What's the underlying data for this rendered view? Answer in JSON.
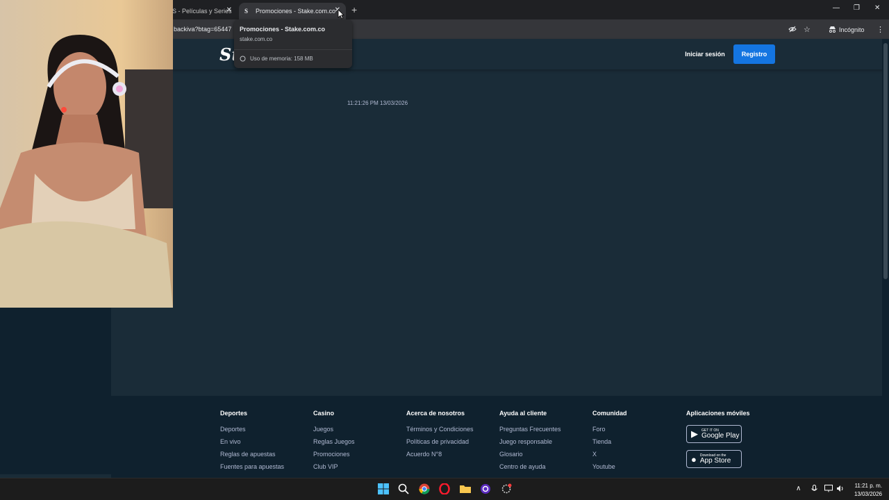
{
  "browser": {
    "tabs": [
      {
        "title": "S - Películas y Series",
        "close": "✕"
      },
      {
        "title": "Promociones - Stake.com.co",
        "favicon": "S",
        "close": "✕"
      }
    ],
    "new_tab": "+",
    "window_controls": {
      "minimize": "—",
      "maximize": "❐",
      "close": "✕"
    },
    "url_text": "backiva?btag=65447",
    "incognito_label": "Incógnito",
    "menu": "⋮"
  },
  "hover_card": {
    "title": "Promociones - Stake.com.co",
    "domain": "stake.com.co",
    "memory": "Uso de memoria: 158 MB"
  },
  "site": {
    "logo": "Stake",
    "login": "Iniciar sesión",
    "register": "Registro",
    "timestamp": "11:21:26 PM 13/03/2026",
    "accent_color": "#1475e1"
  },
  "footer": {
    "columns": [
      {
        "heading": "Deportes",
        "links": [
          "Deportes",
          "En vivo",
          "Reglas de apuestas",
          "Fuentes para apuestas"
        ]
      },
      {
        "heading": "Casino",
        "links": [
          "Juegos",
          "Reglas Juegos",
          "Promociones",
          "Club VIP"
        ]
      },
      {
        "heading": "Acerca de nosotros",
        "links": [
          "Términos y Condiciones",
          "Políticas de privacidad",
          "Acuerdo N°8"
        ]
      },
      {
        "heading": "Ayuda al cliente",
        "links": [
          "Preguntas Frecuentes",
          "Juego responsable",
          "Glosario",
          "Centro de ayuda"
        ]
      },
      {
        "heading": "Comunidad",
        "links": [
          "Foro",
          "Tienda",
          "X",
          "Youtube"
        ]
      }
    ],
    "apps": {
      "heading": "Aplicaciones móviles",
      "google_small": "GET IT ON",
      "google_big": "Google Play",
      "apple_small": "Download on the",
      "apple_big": "App Store"
    }
  },
  "taskbar": {
    "clock_time": "11:21 p. m.",
    "clock_date": "13/03/2026",
    "icons": [
      "windows-start-icon",
      "search-icon",
      "chrome-icon",
      "opera-icon",
      "file-explorer-icon",
      "app-icon",
      "settings-icon"
    ]
  }
}
